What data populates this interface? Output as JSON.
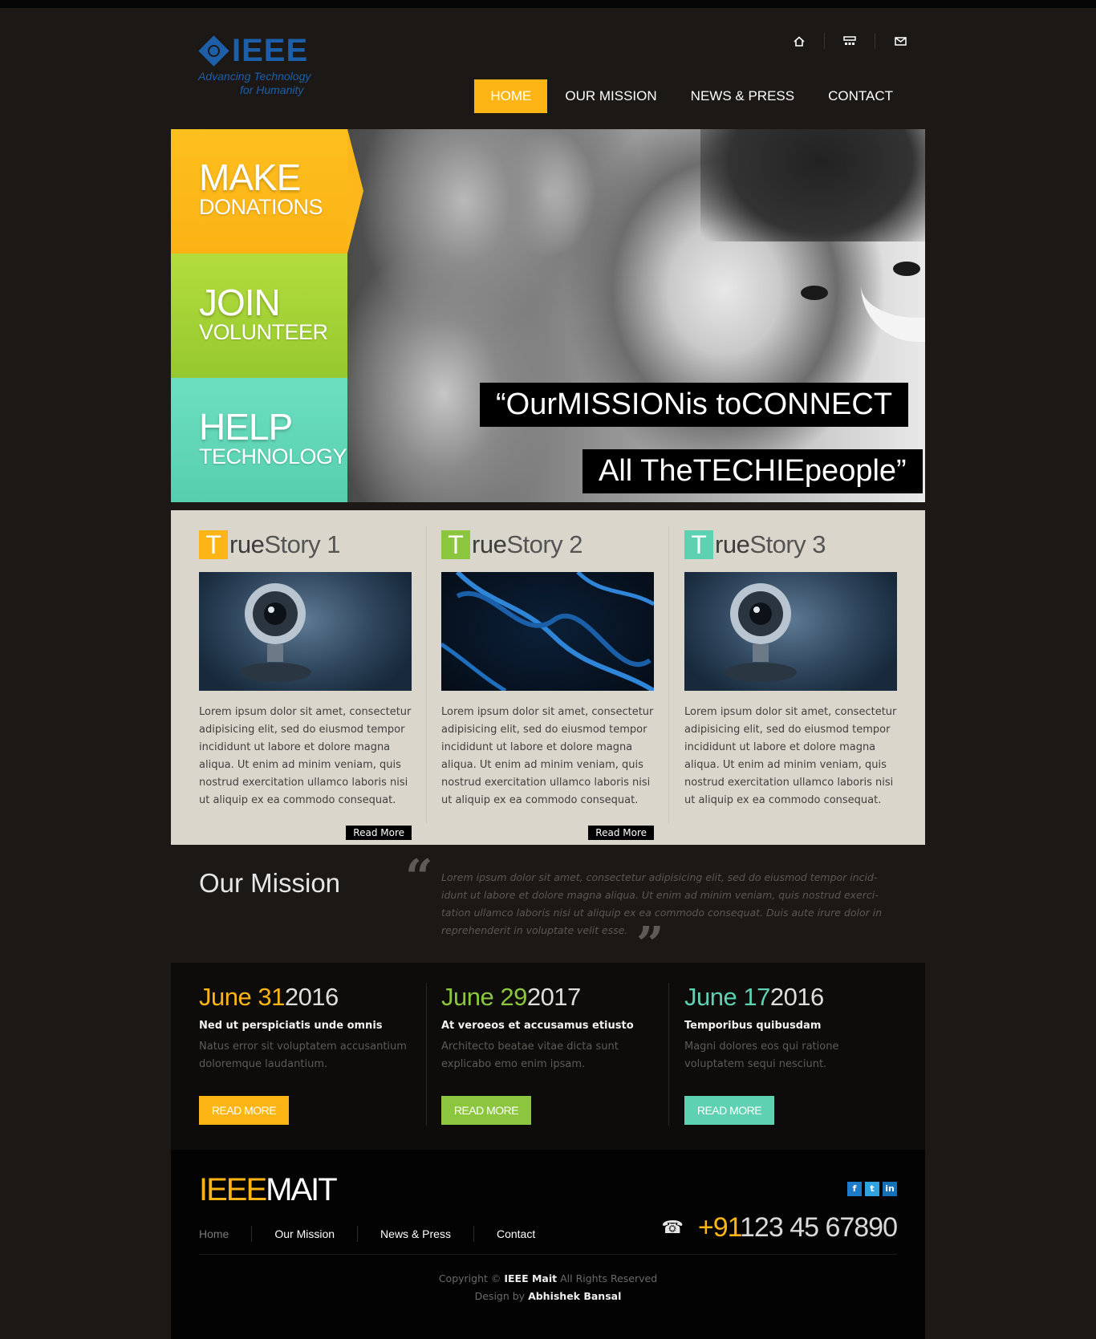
{
  "logo": {
    "word": "IEEE",
    "tag1": "Advancing Technology",
    "tag2": "for Humanity"
  },
  "top_icons": [
    "home-icon",
    "sitemap-icon",
    "mail-icon"
  ],
  "nav": {
    "items": [
      "HOME",
      "OUR MISSION",
      "NEWS & PRESS",
      "CONTACT"
    ],
    "active": "HOME"
  },
  "hero": {
    "panels": [
      {
        "main": "MAKE",
        "sub": "DONATIONS",
        "color": "#fcb514"
      },
      {
        "main": "JOIN",
        "sub": "VOLUNTEER",
        "color": "#a5d138"
      },
      {
        "main": "HELP",
        "sub": "TECHNOLOGY",
        "color": "#62d7b8"
      }
    ],
    "quote_line1": "“OurMISSIONis toCONNECT",
    "quote_line2": "All TheTECHIEpeople”"
  },
  "stories": [
    {
      "letter": "T",
      "rest_bold": "rue",
      "rest": "Story 1",
      "color": "#fcb514",
      "image": "webcam-image",
      "text": "Lorem ipsum dolor sit amet, consectetur adipisicing elit, sed do eiusmod tempor incididunt ut labore et dolore magna aliqua. Ut enim ad minim veniam, quis nostrud exercitation ullamco laboris nisi ut aliquip ex ea commodo consequat.",
      "read_more": "Read More"
    },
    {
      "letter": "T",
      "rest_bold": "rue",
      "rest": "Story 2",
      "color": "#8cc63f",
      "image": "dna-image",
      "text": "Lorem ipsum dolor sit amet, consectetur adipisicing elit, sed do eiusmod tempor incididunt ut labore et dolore magna aliqua. Ut enim ad minim veniam, quis nostrud exercitation ullamco laboris nisi ut aliquip ex ea commodo consequat.",
      "read_more": "Read More"
    },
    {
      "letter": "T",
      "rest_bold": "rue",
      "rest": "Story 3",
      "color": "#5fd1b3",
      "image": "webcam-image",
      "text": "Lorem ipsum dolor sit amet, consectetur adipisicing elit, sed do eiusmod tempor incididunt ut labore et dolore magna aliqua. Ut enim ad minim veniam, quis nostrud exercitation ullamco laboris nisi ut aliquip ex ea commodo consequat."
    }
  ],
  "mission": {
    "title": "Our Mission",
    "text": "Lorem ipsum dolor sit amet, consectetur adipisicing elit, sed do eiusmod tempor incid- idunt ut labore et dolore magna aliqua. Ut enim ad minim veniam, quis nostrud exerci- tation ullamco laboris nisi ut aliquip ex ea commodo consequat. Duis aute irure dolor in reprehenderit in voluptate velit esse."
  },
  "events": [
    {
      "month_day": "June 31",
      "year": "2016",
      "color": "#fcb514",
      "title": "Ned ut perspiciatis unde omnis",
      "desc": "Natus error sit voluptatem accusantium doloremque laudantium.",
      "button": "READ MORE"
    },
    {
      "month_day": "June 29",
      "year": "2017",
      "color": "#8cc63f",
      "title": "At veroeos et accusamus etiusto",
      "desc": "Architecto beatae vitae dicta sunt explicabo emo enim ipsam.",
      "button": "READ MORE"
    },
    {
      "month_day": "June 17",
      "year": "2016",
      "color": "#5fd1b3",
      "title": "Temporibus quibusdam",
      "desc": "Magni dolores eos qui ratione voluptatem sequi nesciunt.",
      "button": "READ MORE"
    }
  ],
  "footer": {
    "brand_a": "IEEE",
    "brand_b": "MAIT",
    "social": [
      "f",
      "t",
      "in"
    ],
    "nav": [
      "Home",
      "Our Mission",
      "News & Press",
      "Contact"
    ],
    "phone_cc": "+91",
    "phone_num": "123 45 67890",
    "copyright_pre": "Copyright ©",
    "copyright_name": "IEEE Mait",
    "copyright_post": "All Rights Reserved",
    "design_pre": "Design by",
    "design_name": "Abhishek Bansal"
  }
}
